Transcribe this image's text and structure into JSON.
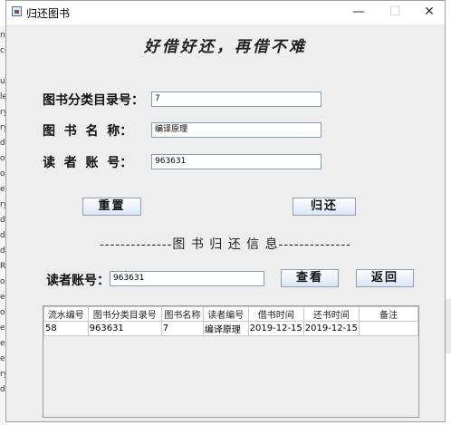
{
  "window": {
    "title": "归还图书",
    "minimize_glyph": "—",
    "maximize_glyph": "☐",
    "close_glyph": "✕"
  },
  "headline": "好借好还，再借不难",
  "form": {
    "catalog_label": "图书分类目录号：",
    "catalog_value": "7",
    "name_label": "图  书  名  称：",
    "name_value": "编译原理",
    "account_label": "读  者  账  号：",
    "account_value": "963631",
    "reset_label": "重置",
    "return_label": "归还"
  },
  "section_title": "--------------图 书 归 还 信 息--------------",
  "query": {
    "account_label": "读者账号：",
    "account_value": "963631",
    "search_label": "查看",
    "back_label": "返回"
  },
  "table": {
    "headers": [
      "流水编号",
      "图书分类目录号",
      "图书名称",
      "读者编号",
      "借书时间",
      "还书时间",
      "备注"
    ],
    "rows": [
      [
        "58",
        "963631",
        "7",
        "编译原理",
        "2019-12-15",
        "2019-12-15",
        ""
      ]
    ]
  },
  "background_app": {
    "left_edge_text": [
      "na",
      "ce",
      "",
      "ul",
      "le",
      "ry",
      "ry",
      "dr",
      "oc",
      "or",
      "ea",
      "ry",
      "dr",
      "dr",
      "dr",
      "Re",
      "or",
      "ea",
      "or",
      "eg",
      "ea",
      "et",
      "ry",
      "db"
    ]
  }
}
